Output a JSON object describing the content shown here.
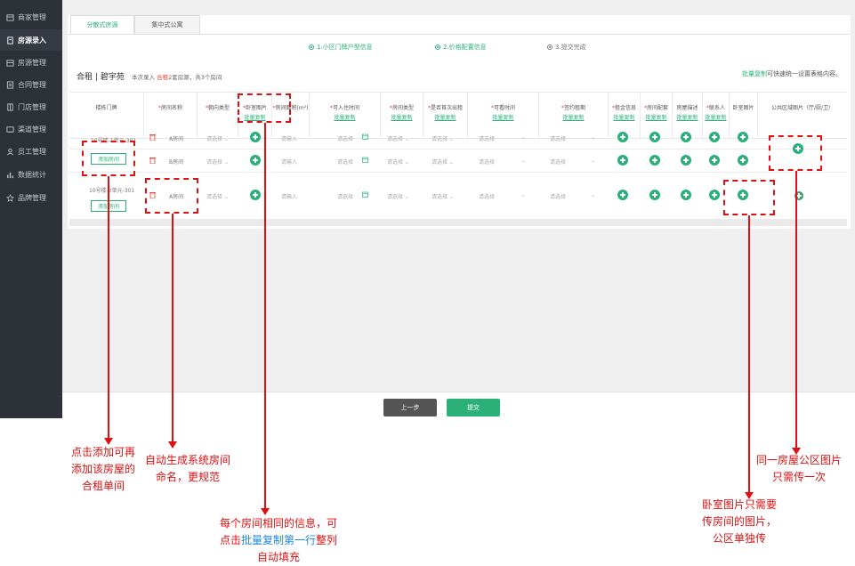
{
  "sidebar": {
    "items": [
      {
        "label": "商家管理",
        "icon": "store-icon"
      },
      {
        "label": "房源录入",
        "icon": "house-entry-icon"
      },
      {
        "label": "房源管理",
        "icon": "house-manage-icon"
      },
      {
        "label": "合同管理",
        "icon": "contract-icon"
      },
      {
        "label": "门店管理",
        "icon": "shop-icon"
      },
      {
        "label": "渠道管理",
        "icon": "channel-icon"
      },
      {
        "label": "员工管理",
        "icon": "staff-icon"
      },
      {
        "label": "数据统计",
        "icon": "chart-icon"
      },
      {
        "label": "品牌管理",
        "icon": "star-icon"
      }
    ],
    "active_index": 1
  },
  "tabs": [
    "分散式房源",
    "集中式公寓"
  ],
  "steps": [
    "1.小区门牌户型信息",
    "2.价格配置信息",
    "3.提交完成"
  ],
  "house": {
    "title": "合租 | 碧宇苑",
    "note_prefix": "本次录入",
    "note_red": "合租",
    "note_suffix": "2套房源，共3个房间",
    "batch_link": "批量复制",
    "batch_tip": "可快速统一设置表格内容。"
  },
  "table": {
    "columns": [
      {
        "label": "楼栋门牌",
        "required": false,
        "batch": ""
      },
      {
        "label": "房间名称",
        "required": true,
        "batch": ""
      },
      {
        "label": "朝向类型",
        "required": true,
        "batch": ""
      },
      {
        "label": "卧室图片",
        "required": true,
        "batch": "批量复制"
      },
      {
        "label": "房间面积(m²)",
        "required": true,
        "batch": ""
      },
      {
        "label": "可入住时间",
        "required": true,
        "batch": "批量复制"
      },
      {
        "label": "房间类型",
        "required": true,
        "batch": "批量复制"
      },
      {
        "label": "是否首次出租",
        "required": true,
        "batch": "批量复制"
      },
      {
        "label": "可看时间",
        "required": true,
        "batch": "批量复制"
      },
      {
        "label": "签约租期",
        "required": true,
        "batch": "批量复制"
      },
      {
        "label": "租金信息",
        "required": true,
        "batch": "批量复制"
      },
      {
        "label": "房间配套",
        "required": true,
        "batch": "批量复制"
      },
      {
        "label": "房屋描述",
        "required": false,
        "batch": "批量复制"
      },
      {
        "label": "联系人",
        "required": true,
        "batch": "批量复制"
      },
      {
        "label": "卧室图片",
        "required": false,
        "batch": ""
      },
      {
        "label": "公共区域图片（厅/厨/卫）",
        "required": false,
        "batch": ""
      }
    ],
    "groups": [
      {
        "address": "10号楼-1单元-301",
        "add_label": "添加房间",
        "rooms": [
          "A房间",
          "B房间"
        ]
      },
      {
        "address": "10号楼-2单元-301",
        "add_label": "添加房间",
        "rooms": [
          "A房间"
        ]
      }
    ],
    "select_placeholder": "请选择",
    "input_placeholder": "请输入"
  },
  "buttons": {
    "prev": "上一步",
    "submit": "提交"
  },
  "annotations": {
    "add_room": "点击添加可再\n添加该房屋的\n合租单间",
    "auto_name": "自动生成系统房间\n命名，更规范",
    "batch_copy_prefix": "每个房间相同的信息，可\n点击",
    "batch_copy_blue": "批量复制第一行",
    "batch_copy_suffix": "整列\n自动填充",
    "bedroom": "卧室图片只需要\n传房间的图片，\n公区单独传",
    "public": "同一房屋公区图片\n只需传一次"
  },
  "colors": {
    "accent": "#2bb07a",
    "sidebar": "#2d3138",
    "annotation": "#dd1111",
    "annotation_link": "#1e88e5"
  }
}
